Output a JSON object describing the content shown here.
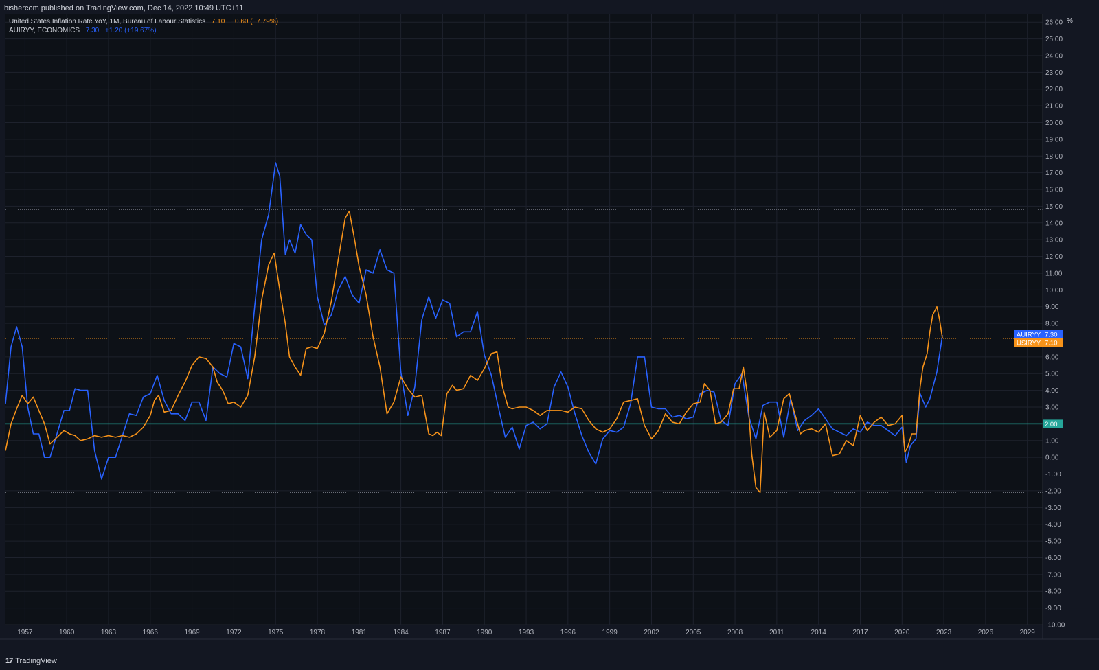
{
  "header": {
    "published": "bishercom published on TradingView.com, Dec 14, 2022 10:49 UTC+11"
  },
  "legend": [
    {
      "name": "United States Inflation Rate YoY, 1M, Bureau of Labour Statistics",
      "value": "7.10",
      "change": "−0.60 (−7.79%)",
      "color": "#f7931a"
    },
    {
      "name": "AUIRYY, ECONOMICS",
      "value": "7.30",
      "change": "+1.20 (+19.67%)",
      "color": "#2962ff"
    }
  ],
  "footer": {
    "brand": "TradingView"
  },
  "chart_data": {
    "type": "line",
    "y_unit": "%",
    "ylim": [
      -10,
      26.5
    ],
    "xlim": [
      1955.6,
      2030.1
    ],
    "x_ticks": [
      "1957",
      "1960",
      "1963",
      "1966",
      "1969",
      "1972",
      "1975",
      "1978",
      "1981",
      "1984",
      "1987",
      "1990",
      "1993",
      "1996",
      "1999",
      "2002",
      "2005",
      "2008",
      "2011",
      "2014",
      "2017",
      "2020",
      "2023",
      "2026",
      "2029"
    ],
    "y_ticks": [
      "26.00",
      "25.00",
      "24.00",
      "23.00",
      "22.00",
      "21.00",
      "20.00",
      "19.00",
      "18.00",
      "17.00",
      "16.00",
      "15.00",
      "14.00",
      "13.00",
      "12.00",
      "11.00",
      "10.00",
      "9.00",
      "8.00",
      "7.00",
      "6.00",
      "5.00",
      "4.00",
      "3.00",
      "2.00",
      "1.00",
      "0.00",
      "-1.00",
      "-2.00",
      "-3.00",
      "-4.00",
      "-5.00",
      "-6.00",
      "-7.00",
      "-8.00",
      "-9.00",
      "-10.00"
    ],
    "reference_lines": [
      {
        "y": 2.0,
        "label": "2.00",
        "color": "#26a69a"
      },
      {
        "y": 14.8,
        "color": "#787b86"
      },
      {
        "y": 7.1,
        "color": "#f7931a"
      },
      {
        "y": -2.1,
        "color": "#787b86"
      }
    ],
    "series": [
      {
        "name": "USIRYY",
        "label": "USIRYY",
        "last": "7.10",
        "color": "#f7931a",
        "x": [
          1955.6,
          1956.0,
          1956.4,
          1956.8,
          1957.2,
          1957.6,
          1958.0,
          1958.4,
          1958.8,
          1959.3,
          1959.8,
          1960.2,
          1960.6,
          1961.0,
          1961.5,
          1962.0,
          1962.5,
          1963.0,
          1963.5,
          1964.0,
          1964.5,
          1965.0,
          1965.5,
          1966.0,
          1966.3,
          1966.6,
          1967.0,
          1967.5,
          1968.0,
          1968.5,
          1969.0,
          1969.5,
          1970.0,
          1970.5,
          1970.8,
          1971.2,
          1971.6,
          1972.0,
          1972.5,
          1973.0,
          1973.5,
          1974.0,
          1974.5,
          1974.9,
          1975.3,
          1975.7,
          1976.0,
          1976.4,
          1976.8,
          1977.2,
          1977.6,
          1978.0,
          1978.5,
          1979.0,
          1979.5,
          1980.0,
          1980.3,
          1980.7,
          1981.0,
          1981.5,
          1982.0,
          1982.5,
          1983.0,
          1983.5,
          1984.0,
          1984.5,
          1985.0,
          1985.5,
          1986.0,
          1986.3,
          1986.6,
          1986.9,
          1987.3,
          1987.7,
          1988.0,
          1988.5,
          1989.0,
          1989.5,
          1990.0,
          1990.5,
          1990.9,
          1991.3,
          1991.7,
          1992.0,
          1992.5,
          1993.0,
          1993.5,
          1994.0,
          1994.5,
          1995.0,
          1995.5,
          1996.0,
          1996.5,
          1997.0,
          1997.5,
          1998.0,
          1998.5,
          1999.0,
          1999.5,
          2000.0,
          2000.5,
          2001.0,
          2001.5,
          2002.0,
          2002.5,
          2003.0,
          2003.5,
          2004.0,
          2004.5,
          2005.0,
          2005.5,
          2005.8,
          2006.2,
          2006.6,
          2007.0,
          2007.5,
          2007.9,
          2008.3,
          2008.6,
          2008.9,
          2009.2,
          2009.5,
          2009.8,
          2010.1,
          2010.5,
          2011.0,
          2011.5,
          2011.9,
          2012.3,
          2012.7,
          2013.0,
          2013.5,
          2014.0,
          2014.5,
          2015.0,
          2015.5,
          2016.0,
          2016.5,
          2017.0,
          2017.5,
          2018.0,
          2018.5,
          2019.0,
          2019.5,
          2020.0,
          2020.2,
          2020.4,
          2020.7,
          2021.0,
          2021.3,
          2021.5,
          2021.8,
          2022.0,
          2022.2,
          2022.5,
          2022.7,
          2022.9
        ],
        "values": [
          0.4,
          2.0,
          2.9,
          3.7,
          3.2,
          3.6,
          2.8,
          2.0,
          0.8,
          1.2,
          1.6,
          1.4,
          1.3,
          1.0,
          1.1,
          1.3,
          1.2,
          1.3,
          1.2,
          1.3,
          1.2,
          1.4,
          1.8,
          2.5,
          3.4,
          3.7,
          2.7,
          2.8,
          3.7,
          4.5,
          5.5,
          6.0,
          5.9,
          5.4,
          4.5,
          4.0,
          3.2,
          3.3,
          3.0,
          3.7,
          6.0,
          9.4,
          11.5,
          12.2,
          10.0,
          8.0,
          6.0,
          5.4,
          4.9,
          6.5,
          6.6,
          6.5,
          7.4,
          9.3,
          11.8,
          14.3,
          14.7,
          12.9,
          11.4,
          9.7,
          7.2,
          5.4,
          2.6,
          3.3,
          4.8,
          4.1,
          3.6,
          3.7,
          1.4,
          1.3,
          1.5,
          1.3,
          3.8,
          4.3,
          4.0,
          4.1,
          4.9,
          4.6,
          5.3,
          6.2,
          6.3,
          4.2,
          3.0,
          2.9,
          3.0,
          3.0,
          2.8,
          2.5,
          2.8,
          2.8,
          2.8,
          2.7,
          3.0,
          2.9,
          2.2,
          1.7,
          1.5,
          1.7,
          2.3,
          3.3,
          3.4,
          3.5,
          1.9,
          1.1,
          1.6,
          2.6,
          2.1,
          2.0,
          2.7,
          3.2,
          3.3,
          4.4,
          4.0,
          2.0,
          2.1,
          2.6,
          4.1,
          4.1,
          5.4,
          3.7,
          0.2,
          -1.8,
          -2.1,
          2.7,
          1.2,
          1.6,
          3.5,
          3.8,
          2.6,
          1.4,
          1.6,
          1.7,
          1.5,
          2.0,
          0.1,
          0.2,
          1.0,
          0.7,
          2.5,
          1.6,
          2.1,
          2.4,
          1.9,
          2.0,
          2.5,
          0.3,
          0.6,
          1.4,
          1.4,
          4.2,
          5.4,
          6.2,
          7.5,
          8.5,
          9.0,
          8.2,
          7.1
        ]
      },
      {
        "name": "AUIRYY",
        "label": "AUIRYY",
        "last": "7.30",
        "color": "#2962ff",
        "x": [
          1955.6,
          1956.0,
          1956.4,
          1956.8,
          1957.2,
          1957.6,
          1958.0,
          1958.4,
          1958.8,
          1959.3,
          1959.8,
          1960.2,
          1960.6,
          1961.0,
          1961.5,
          1962.0,
          1962.5,
          1963.0,
          1963.5,
          1964.0,
          1964.5,
          1965.0,
          1965.5,
          1966.0,
          1966.5,
          1967.0,
          1967.5,
          1968.0,
          1968.5,
          1969.0,
          1969.5,
          1970.0,
          1970.5,
          1971.0,
          1971.5,
          1972.0,
          1972.5,
          1973.0,
          1973.5,
          1974.0,
          1974.5,
          1975.0,
          1975.3,
          1975.7,
          1976.0,
          1976.4,
          1976.8,
          1977.2,
          1977.6,
          1978.0,
          1978.5,
          1979.0,
          1979.5,
          1980.0,
          1980.5,
          1981.0,
          1981.5,
          1982.0,
          1982.5,
          1983.0,
          1983.5,
          1984.0,
          1984.5,
          1985.0,
          1985.5,
          1986.0,
          1986.5,
          1987.0,
          1987.5,
          1988.0,
          1988.5,
          1989.0,
          1989.5,
          1990.0,
          1990.5,
          1991.0,
          1991.5,
          1992.0,
          1992.5,
          1993.0,
          1993.5,
          1994.0,
          1994.5,
          1995.0,
          1995.5,
          1996.0,
          1996.5,
          1997.0,
          1997.5,
          1998.0,
          1998.5,
          1999.0,
          1999.5,
          2000.0,
          2000.5,
          2001.0,
          2001.5,
          2002.0,
          2002.5,
          2003.0,
          2003.5,
          2004.0,
          2004.5,
          2005.0,
          2005.5,
          2006.0,
          2006.5,
          2007.0,
          2007.5,
          2008.0,
          2008.5,
          2009.0,
          2009.5,
          2010.0,
          2010.5,
          2011.0,
          2011.5,
          2012.0,
          2012.5,
          2013.0,
          2013.5,
          2014.0,
          2014.5,
          2015.0,
          2015.5,
          2016.0,
          2016.5,
          2017.0,
          2017.5,
          2018.0,
          2018.5,
          2019.0,
          2019.5,
          2020.0,
          2020.3,
          2020.6,
          2021.0,
          2021.3,
          2021.7,
          2022.0,
          2022.5,
          2022.9
        ],
        "values": [
          3.2,
          6.6,
          7.8,
          6.6,
          3.0,
          1.4,
          1.4,
          0.0,
          0.0,
          1.4,
          2.8,
          2.8,
          4.1,
          4.0,
          4.0,
          0.4,
          -1.3,
          0.0,
          0.0,
          1.3,
          2.6,
          2.5,
          3.6,
          3.8,
          4.9,
          3.4,
          2.6,
          2.6,
          2.2,
          3.3,
          3.3,
          2.2,
          5.4,
          5.0,
          4.8,
          6.8,
          6.6,
          4.7,
          9.0,
          13.0,
          14.5,
          17.6,
          16.8,
          12.1,
          13.0,
          12.2,
          13.9,
          13.3,
          13.0,
          9.6,
          7.9,
          8.5,
          10.0,
          10.8,
          9.7,
          9.2,
          11.2,
          11.0,
          12.4,
          11.2,
          11.0,
          5.1,
          2.5,
          4.2,
          8.2,
          9.6,
          8.3,
          9.4,
          9.2,
          7.2,
          7.5,
          7.5,
          8.7,
          6.1,
          4.9,
          3.0,
          1.2,
          1.8,
          0.5,
          1.9,
          2.1,
          1.7,
          2.0,
          4.2,
          5.1,
          4.2,
          2.6,
          1.3,
          0.3,
          -0.4,
          1.1,
          1.6,
          1.5,
          1.8,
          3.2,
          6.0,
          6.0,
          3.0,
          2.9,
          2.9,
          2.4,
          2.5,
          2.3,
          2.4,
          3.8,
          4.0,
          3.9,
          2.2,
          1.9,
          4.4,
          5.0,
          2.4,
          1.1,
          3.1,
          3.3,
          3.3,
          1.2,
          3.5,
          1.6,
          2.2,
          2.5,
          2.9,
          2.3,
          1.7,
          1.5,
          1.3,
          1.7,
          1.5,
          2.1,
          1.9,
          1.9,
          1.6,
          1.3,
          1.8,
          -0.3,
          0.7,
          1.1,
          3.8,
          3.0,
          3.5,
          5.1,
          7.3
        ]
      }
    ]
  }
}
